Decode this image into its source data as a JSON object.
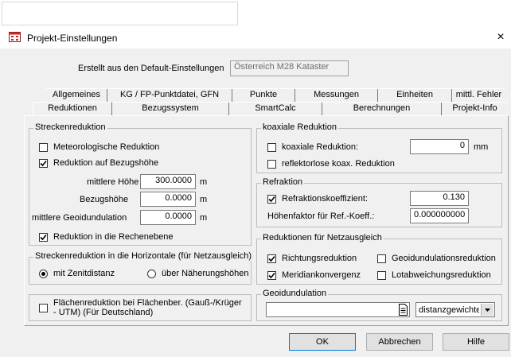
{
  "window": {
    "title": "Projekt-Einstellungen",
    "close_glyph": "×",
    "icon": "project-settings-icon"
  },
  "defaults": {
    "label": "Erstellt aus den Default-Einstellungen",
    "value": "Österreich M28 Kataster"
  },
  "tabs_row1": [
    "Allgemeines",
    "KG / FP-Punktdatei, GFN",
    "Punkte",
    "Messungen",
    "Einheiten",
    "mittl. Fehler"
  ],
  "tabs_row2": [
    "Reduktionen",
    "Bezugssystem",
    "SmartCalc",
    "Berechnungen",
    "Projekt-Info"
  ],
  "active_tab": "Reduktionen",
  "streckenreduktion": {
    "title": "Streckenreduktion",
    "meteo": {
      "label": "Meteorologische Reduktion",
      "checked": false
    },
    "bezug": {
      "label": "Reduktion auf Bezugshöhe",
      "checked": true
    },
    "mittlere_hoehe": {
      "label": "mittlere Höhe",
      "value": "300.0000",
      "unit": "m"
    },
    "bezugshoehe": {
      "label": "Bezugshöhe",
      "value": "0.0000",
      "unit": "m"
    },
    "geoidundulation": {
      "label": "mittlere Geoidundulation",
      "value": "0.0000",
      "unit": "m"
    },
    "rechenebene": {
      "label": "Reduktion in die Rechenebene",
      "checked": true
    }
  },
  "horizontale": {
    "title": "Streckenreduktion in die Horizontale (für Netzausgleich)",
    "zenit": {
      "label": "mit Zenitdistanz",
      "selected": true
    },
    "naeherung": {
      "label": "über Näherungshöhen",
      "selected": false
    }
  },
  "flaechen": {
    "label": "Flächenreduktion bei Flächenber. (Gauß-/Krüger - UTM) (Für Deutschland)",
    "checked": false
  },
  "koaxial": {
    "title": "koaxiale Reduktion",
    "koax": {
      "label": "koaxiale Reduktion:",
      "checked": false,
      "value": "0",
      "unit": "mm"
    },
    "reflektorlos": {
      "label": "reflektorlose koax. Reduktion",
      "checked": false
    }
  },
  "refraktion": {
    "title": "Refraktion",
    "koeff": {
      "label": "Refraktionskoeffizient:",
      "checked": true,
      "value": "0.130"
    },
    "hoehenfaktor": {
      "label": "Höhenfaktor für Ref.-Koeff.:",
      "value": "0.000000000"
    }
  },
  "netzausgleich": {
    "title": "Reduktionen für Netzausgleich",
    "richtung": {
      "label": "Richtungsreduktion",
      "checked": true
    },
    "geoid": {
      "label": "Geoidundulationsreduktion",
      "checked": false
    },
    "meridian": {
      "label": "Meridiankonvergenz",
      "checked": true
    },
    "lotab": {
      "label": "Lotabweichungsreduktion",
      "checked": false
    }
  },
  "geoidundulation": {
    "title": "Geoidundulation",
    "file_value": "",
    "browse_icon": "file-browse-icon",
    "method": "distanzgewichte"
  },
  "buttons": {
    "ok": "OK",
    "cancel": "Abbrechen",
    "help": "Hilfe"
  }
}
